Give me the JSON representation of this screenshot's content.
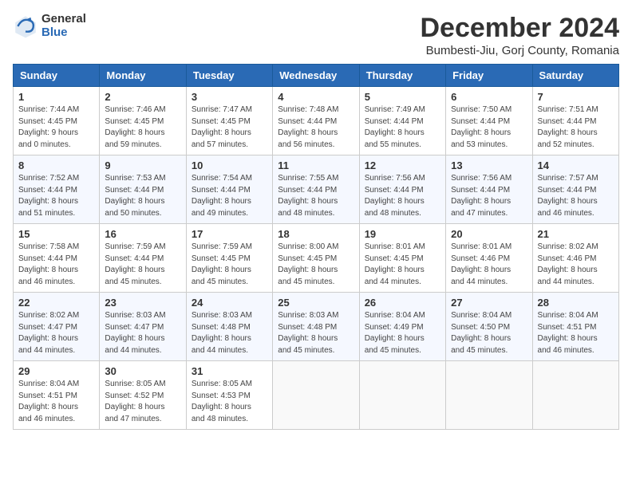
{
  "header": {
    "logo_general": "General",
    "logo_blue": "Blue",
    "month_title": "December 2024",
    "location": "Bumbesti-Jiu, Gorj County, Romania"
  },
  "weekdays": [
    "Sunday",
    "Monday",
    "Tuesday",
    "Wednesday",
    "Thursday",
    "Friday",
    "Saturday"
  ],
  "weeks": [
    [
      {
        "day": "1",
        "lines": [
          "Sunrise: 7:44 AM",
          "Sunset: 4:45 PM",
          "Daylight: 9 hours",
          "and 0 minutes."
        ]
      },
      {
        "day": "2",
        "lines": [
          "Sunrise: 7:46 AM",
          "Sunset: 4:45 PM",
          "Daylight: 8 hours",
          "and 59 minutes."
        ]
      },
      {
        "day": "3",
        "lines": [
          "Sunrise: 7:47 AM",
          "Sunset: 4:45 PM",
          "Daylight: 8 hours",
          "and 57 minutes."
        ]
      },
      {
        "day": "4",
        "lines": [
          "Sunrise: 7:48 AM",
          "Sunset: 4:44 PM",
          "Daylight: 8 hours",
          "and 56 minutes."
        ]
      },
      {
        "day": "5",
        "lines": [
          "Sunrise: 7:49 AM",
          "Sunset: 4:44 PM",
          "Daylight: 8 hours",
          "and 55 minutes."
        ]
      },
      {
        "day": "6",
        "lines": [
          "Sunrise: 7:50 AM",
          "Sunset: 4:44 PM",
          "Daylight: 8 hours",
          "and 53 minutes."
        ]
      },
      {
        "day": "7",
        "lines": [
          "Sunrise: 7:51 AM",
          "Sunset: 4:44 PM",
          "Daylight: 8 hours",
          "and 52 minutes."
        ]
      }
    ],
    [
      {
        "day": "8",
        "lines": [
          "Sunrise: 7:52 AM",
          "Sunset: 4:44 PM",
          "Daylight: 8 hours",
          "and 51 minutes."
        ]
      },
      {
        "day": "9",
        "lines": [
          "Sunrise: 7:53 AM",
          "Sunset: 4:44 PM",
          "Daylight: 8 hours",
          "and 50 minutes."
        ]
      },
      {
        "day": "10",
        "lines": [
          "Sunrise: 7:54 AM",
          "Sunset: 4:44 PM",
          "Daylight: 8 hours",
          "and 49 minutes."
        ]
      },
      {
        "day": "11",
        "lines": [
          "Sunrise: 7:55 AM",
          "Sunset: 4:44 PM",
          "Daylight: 8 hours",
          "and 48 minutes."
        ]
      },
      {
        "day": "12",
        "lines": [
          "Sunrise: 7:56 AM",
          "Sunset: 4:44 PM",
          "Daylight: 8 hours",
          "and 48 minutes."
        ]
      },
      {
        "day": "13",
        "lines": [
          "Sunrise: 7:56 AM",
          "Sunset: 4:44 PM",
          "Daylight: 8 hours",
          "and 47 minutes."
        ]
      },
      {
        "day": "14",
        "lines": [
          "Sunrise: 7:57 AM",
          "Sunset: 4:44 PM",
          "Daylight: 8 hours",
          "and 46 minutes."
        ]
      }
    ],
    [
      {
        "day": "15",
        "lines": [
          "Sunrise: 7:58 AM",
          "Sunset: 4:44 PM",
          "Daylight: 8 hours",
          "and 46 minutes."
        ]
      },
      {
        "day": "16",
        "lines": [
          "Sunrise: 7:59 AM",
          "Sunset: 4:44 PM",
          "Daylight: 8 hours",
          "and 45 minutes."
        ]
      },
      {
        "day": "17",
        "lines": [
          "Sunrise: 7:59 AM",
          "Sunset: 4:45 PM",
          "Daylight: 8 hours",
          "and 45 minutes."
        ]
      },
      {
        "day": "18",
        "lines": [
          "Sunrise: 8:00 AM",
          "Sunset: 4:45 PM",
          "Daylight: 8 hours",
          "and 45 minutes."
        ]
      },
      {
        "day": "19",
        "lines": [
          "Sunrise: 8:01 AM",
          "Sunset: 4:45 PM",
          "Daylight: 8 hours",
          "and 44 minutes."
        ]
      },
      {
        "day": "20",
        "lines": [
          "Sunrise: 8:01 AM",
          "Sunset: 4:46 PM",
          "Daylight: 8 hours",
          "and 44 minutes."
        ]
      },
      {
        "day": "21",
        "lines": [
          "Sunrise: 8:02 AM",
          "Sunset: 4:46 PM",
          "Daylight: 8 hours",
          "and 44 minutes."
        ]
      }
    ],
    [
      {
        "day": "22",
        "lines": [
          "Sunrise: 8:02 AM",
          "Sunset: 4:47 PM",
          "Daylight: 8 hours",
          "and 44 minutes."
        ]
      },
      {
        "day": "23",
        "lines": [
          "Sunrise: 8:03 AM",
          "Sunset: 4:47 PM",
          "Daylight: 8 hours",
          "and 44 minutes."
        ]
      },
      {
        "day": "24",
        "lines": [
          "Sunrise: 8:03 AM",
          "Sunset: 4:48 PM",
          "Daylight: 8 hours",
          "and 44 minutes."
        ]
      },
      {
        "day": "25",
        "lines": [
          "Sunrise: 8:03 AM",
          "Sunset: 4:48 PM",
          "Daylight: 8 hours",
          "and 45 minutes."
        ]
      },
      {
        "day": "26",
        "lines": [
          "Sunrise: 8:04 AM",
          "Sunset: 4:49 PM",
          "Daylight: 8 hours",
          "and 45 minutes."
        ]
      },
      {
        "day": "27",
        "lines": [
          "Sunrise: 8:04 AM",
          "Sunset: 4:50 PM",
          "Daylight: 8 hours",
          "and 45 minutes."
        ]
      },
      {
        "day": "28",
        "lines": [
          "Sunrise: 8:04 AM",
          "Sunset: 4:51 PM",
          "Daylight: 8 hours",
          "and 46 minutes."
        ]
      }
    ],
    [
      {
        "day": "29",
        "lines": [
          "Sunrise: 8:04 AM",
          "Sunset: 4:51 PM",
          "Daylight: 8 hours",
          "and 46 minutes."
        ]
      },
      {
        "day": "30",
        "lines": [
          "Sunrise: 8:05 AM",
          "Sunset: 4:52 PM",
          "Daylight: 8 hours",
          "and 47 minutes."
        ]
      },
      {
        "day": "31",
        "lines": [
          "Sunrise: 8:05 AM",
          "Sunset: 4:53 PM",
          "Daylight: 8 hours",
          "and 48 minutes."
        ]
      },
      null,
      null,
      null,
      null
    ]
  ]
}
